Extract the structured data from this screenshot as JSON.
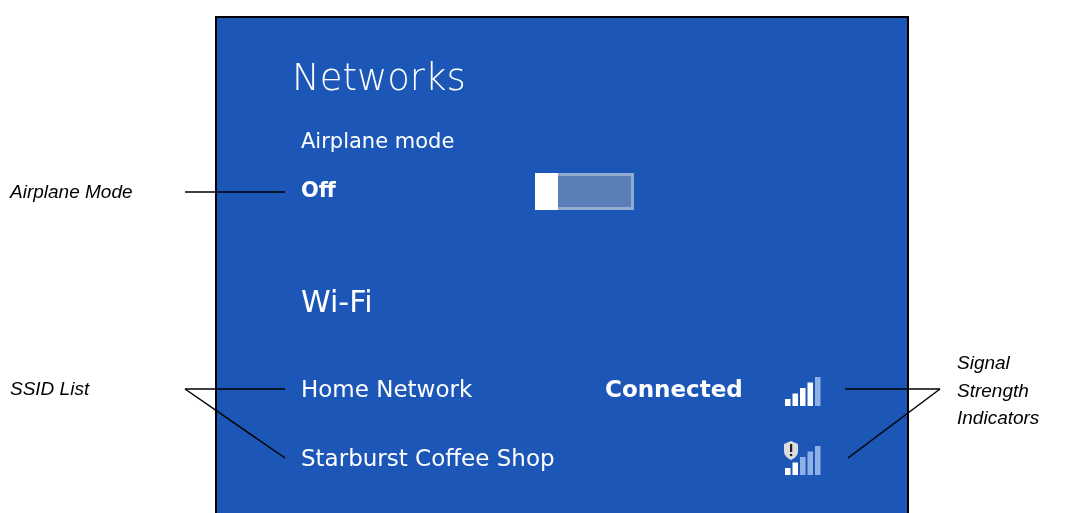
{
  "panel": {
    "title": "Networks",
    "airplane_mode": {
      "label": "Airplane mode",
      "state_text": "Off",
      "on": false
    },
    "wifi": {
      "heading": "Wi-Fi",
      "networks": [
        {
          "name": "Home Network",
          "status": "Connected",
          "kind": "strong",
          "security_warning": false
        },
        {
          "name": "Starburst Coffee Shop",
          "kind": "weak",
          "security_warning": true
        }
      ]
    }
  },
  "left_callouts": [
    "Airplane Mode",
    "SSID List"
  ],
  "right_callouts": [
    "Signal Strength Indicators"
  ]
}
